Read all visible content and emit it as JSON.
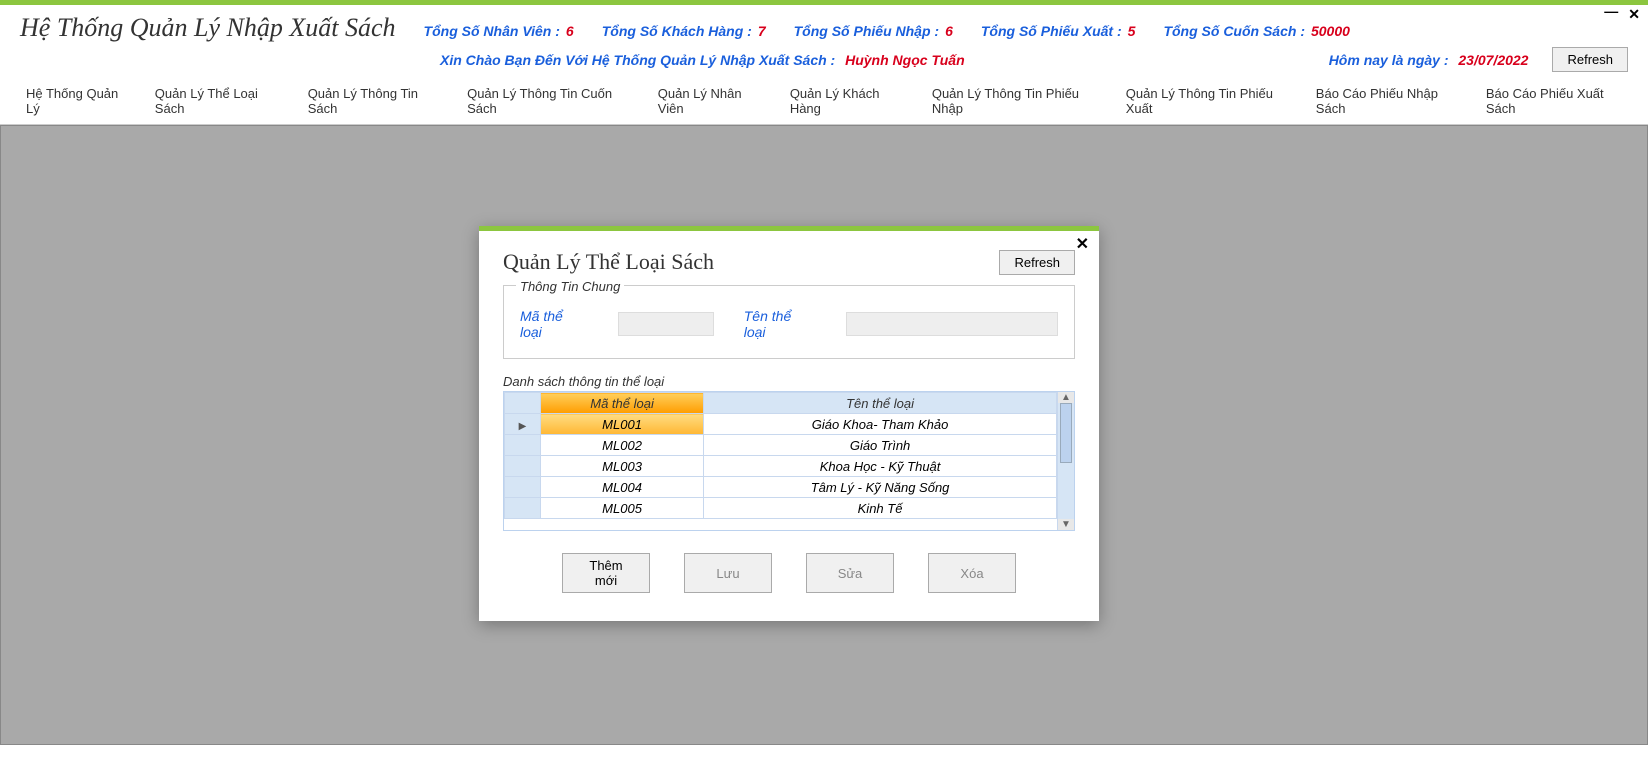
{
  "app_title": "Hệ Thống Quản Lý Nhập Xuất Sách",
  "stats": {
    "nhanvien_label": "Tổng Số Nhân Viên :",
    "nhanvien_val": "6",
    "khachhang_label": "Tổng Số Khách Hàng :",
    "khachhang_val": "7",
    "phieunhap_label": "Tổng Số Phiếu Nhập :",
    "phieunhap_val": "6",
    "phieuxuat_label": "Tổng Số Phiếu Xuất :",
    "phieuxuat_val": "5",
    "cuonsach_label": "Tổng Số Cuốn Sách :",
    "cuonsach_val": "50000"
  },
  "welcome_label": "Xin Chào Bạn Đến Với Hệ Thống Quản Lý Nhập Xuất Sách :",
  "welcome_user": "Huỳnh Ngọc Tuấn",
  "today_label": "Hôm nay là ngày :",
  "today_date": "23/07/2022",
  "refresh_label": "Refresh",
  "menu": {
    "m0": "Hệ Thống Quản Lý",
    "m1": "Quản Lý Thể Loại Sách",
    "m2": "Quản Lý Thông Tin Sách",
    "m3": "Quản Lý Thông Tin Cuốn Sách",
    "m4": "Quản Lý Nhân Viên",
    "m5": "Quản Lý Khách Hàng",
    "m6": "Quản Lý Thông Tin Phiếu Nhập",
    "m7": "Quản Lý Thông Tin Phiếu Xuất",
    "m8": "Báo Cáo Phiếu Nhập Sách",
    "m9": "Báo Cáo Phiếu Xuất Sách"
  },
  "dialog": {
    "title": "Quản Lý Thể Loại Sách",
    "refresh": "Refresh",
    "fieldset1_legend": "Thông Tin Chung",
    "label_ma": "Mã thể loại",
    "label_ten": "Tên thể loại",
    "fieldset2_legend": "Danh sách thông tin thể loại",
    "col_ma": "Mã thể loại",
    "col_ten": "Tên thể loại",
    "rows": [
      {
        "ma": "ML001",
        "ten": "Giáo Khoa- Tham Khảo"
      },
      {
        "ma": "ML002",
        "ten": "Giáo Trình"
      },
      {
        "ma": "ML003",
        "ten": "Khoa Học - Kỹ Thuật"
      },
      {
        "ma": "ML004",
        "ten": "Tâm Lý - Kỹ Năng Sống"
      },
      {
        "ma": "ML005",
        "ten": "Kinh Tế"
      }
    ],
    "btn_them": "Thêm mới",
    "btn_luu": "Lưu",
    "btn_sua": "Sửa",
    "btn_xoa": "Xóa"
  }
}
